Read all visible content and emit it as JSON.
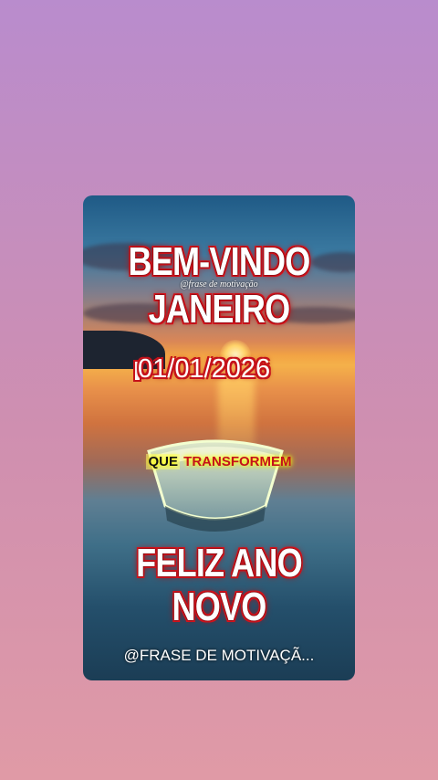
{
  "title_line1": "BEM-VINDO",
  "title_line2": "JANEIRO",
  "handle": "@frase de motivação",
  "date": "01/01/2026",
  "subtitle_part1": "QUE",
  "subtitle_part2": "TRANSFORMEM",
  "greeting_line1": "FELIZ ANO",
  "greeting_line2": "NOVO",
  "footer": "@FRASE DE MOTIVAÇÃ...",
  "colors": {
    "accent_red": "#d8121b",
    "text_white": "#ffffff"
  },
  "icons": [
    "calendar-icon"
  ]
}
